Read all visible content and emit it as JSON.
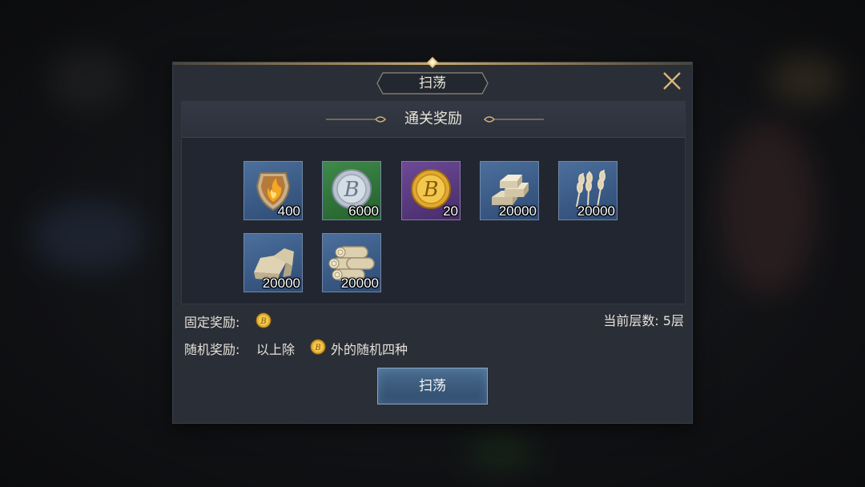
{
  "dialog": {
    "title": "扫荡",
    "section_title": "通关奖励"
  },
  "rewards": [
    {
      "icon": "flame-shield-icon",
      "quantity": "400",
      "rarity": "blue"
    },
    {
      "icon": "silver-coin-icon",
      "quantity": "6000",
      "rarity": "green"
    },
    {
      "icon": "gold-coin-icon",
      "quantity": "20",
      "rarity": "purple"
    },
    {
      "icon": "silver-ingot-icon",
      "quantity": "20000",
      "rarity": "blue"
    },
    {
      "icon": "wheat-icon",
      "quantity": "20000",
      "rarity": "blue"
    },
    {
      "icon": "stone-icon",
      "quantity": "20000",
      "rarity": "blue"
    },
    {
      "icon": "wood-logs-icon",
      "quantity": "20000",
      "rarity": "blue"
    }
  ],
  "info": {
    "fixed_label": "固定奖励:",
    "floor_label": "当前层数: 5层",
    "random_label": "随机奖励:",
    "random_prefix": "以上除",
    "random_suffix": "外的随机四种"
  },
  "sweep_button": "扫荡",
  "colors": {
    "panel": "#2a2e36",
    "gold_accent": "#c9a866",
    "button": "#3d5c7e"
  }
}
